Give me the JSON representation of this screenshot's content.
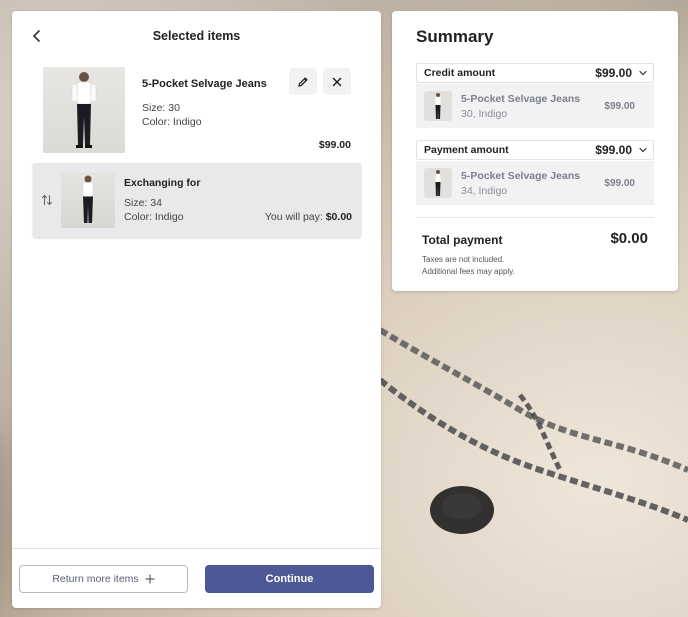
{
  "left_panel": {
    "title": "Selected items",
    "item": {
      "name": "5-Pocket Selvage Jeans",
      "size": "Size: 30",
      "color": "Color: Indigo",
      "price": "$99.00",
      "thumb_icon": "product-photo-jeans"
    },
    "exchange": {
      "title": "Exchanging for",
      "size": "Size: 34",
      "color": "Color: Indigo",
      "pay_label": "You will pay:",
      "pay_value": "$0.00"
    },
    "footer": {
      "return_more_label": "Return more items",
      "continue_label": "Continue"
    }
  },
  "summary": {
    "title": "Summary",
    "credit": {
      "label": "Credit amount",
      "value": "$99.00",
      "item": {
        "name": "5-Pocket Selvage Jeans",
        "meta": "30, Indigo",
        "price": "$99.00"
      }
    },
    "payment": {
      "label": "Payment amount",
      "value": "$99.00",
      "item": {
        "name": "5-Pocket Selvage Jeans",
        "meta": "34, Indigo",
        "price": "$99.00"
      }
    },
    "total_label": "Total payment",
    "total_value": "$0.00",
    "note_1": "Taxes are not included.",
    "note_2": "Additional fees may apply."
  },
  "colors": {
    "primary": "#4f5897",
    "outline": "#b9bcc7",
    "muted_text": "#7c7f8d"
  }
}
